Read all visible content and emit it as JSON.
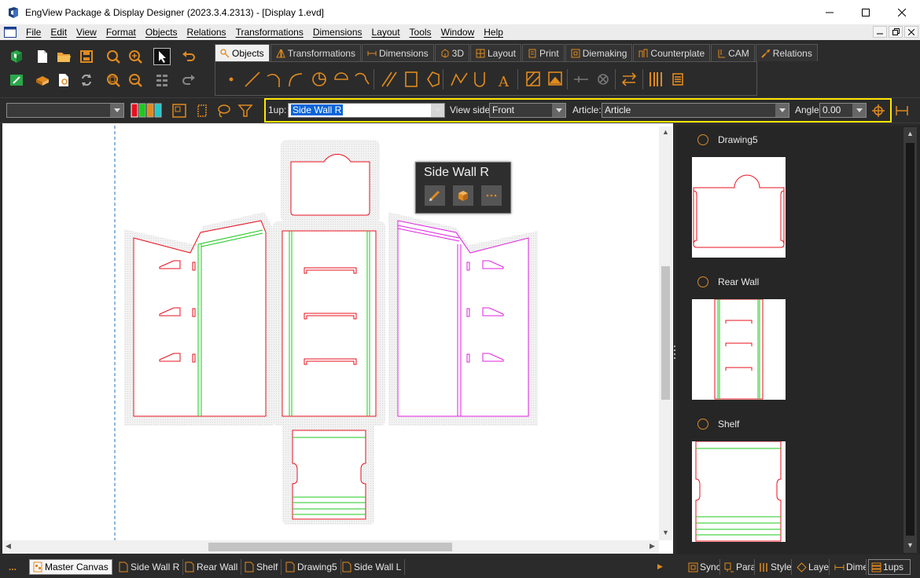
{
  "window": {
    "title": "EngView Package & Display Designer (2023.3.4.2313) - [Display 1.evd]",
    "controls": [
      "minimize",
      "maximize",
      "close"
    ]
  },
  "menu": {
    "items": [
      "File",
      "Edit",
      "View",
      "Format",
      "Objects",
      "Relations",
      "Transformations",
      "Dimensions",
      "Layout",
      "Tools",
      "Window",
      "Help"
    ]
  },
  "ribbon": {
    "tabs": [
      {
        "label": "Objects",
        "icon": "objects-icon",
        "active": true
      },
      {
        "label": "Transformations",
        "icon": "transformations-icon"
      },
      {
        "label": "Dimensions",
        "icon": "dimensions-icon"
      },
      {
        "label": "3D",
        "icon": "3d-icon"
      },
      {
        "label": "Layout",
        "icon": "layout-icon"
      },
      {
        "label": "Print",
        "icon": "print-icon"
      },
      {
        "label": "Diemaking",
        "icon": "diemaking-icon"
      },
      {
        "label": "Counterplate",
        "icon": "counterplate-icon"
      },
      {
        "label": "CAM",
        "icon": "cam-icon"
      },
      {
        "label": "Relations",
        "icon": "relations-icon"
      }
    ]
  },
  "propbar": {
    "style_value": "",
    "oneup_label": "1up:",
    "oneup_value": "Side Wall R",
    "viewside_label": "View side",
    "viewside_value": "Front",
    "article_label": "Article:",
    "article_value": "Article",
    "angle_label": "Angle",
    "angle_value": "0.00"
  },
  "popup": {
    "title": "Side Wall R",
    "buttons": [
      "edit-pencil-icon",
      "3d-box-icon",
      "more-icon"
    ]
  },
  "panel": {
    "items": [
      {
        "label": "Drawing5"
      },
      {
        "label": "Rear Wall"
      },
      {
        "label": "Shelf"
      }
    ]
  },
  "bottom_tabs": {
    "more": "...",
    "items": [
      "Master Canvas",
      "Side Wall R",
      "Rear Wall",
      "Shelf",
      "Drawing5",
      "Side Wall L"
    ],
    "active": "Master Canvas"
  },
  "right_bottom_tabs": [
    "Sync",
    "Para",
    "Style",
    "Layer",
    "Dime",
    "1ups"
  ],
  "colors": {
    "cut_line": "#e8101e",
    "crease_line": "#1ec81e",
    "selected_line": "#e020e0",
    "accent": "#e08a1e",
    "highlight": "#ffe600"
  }
}
